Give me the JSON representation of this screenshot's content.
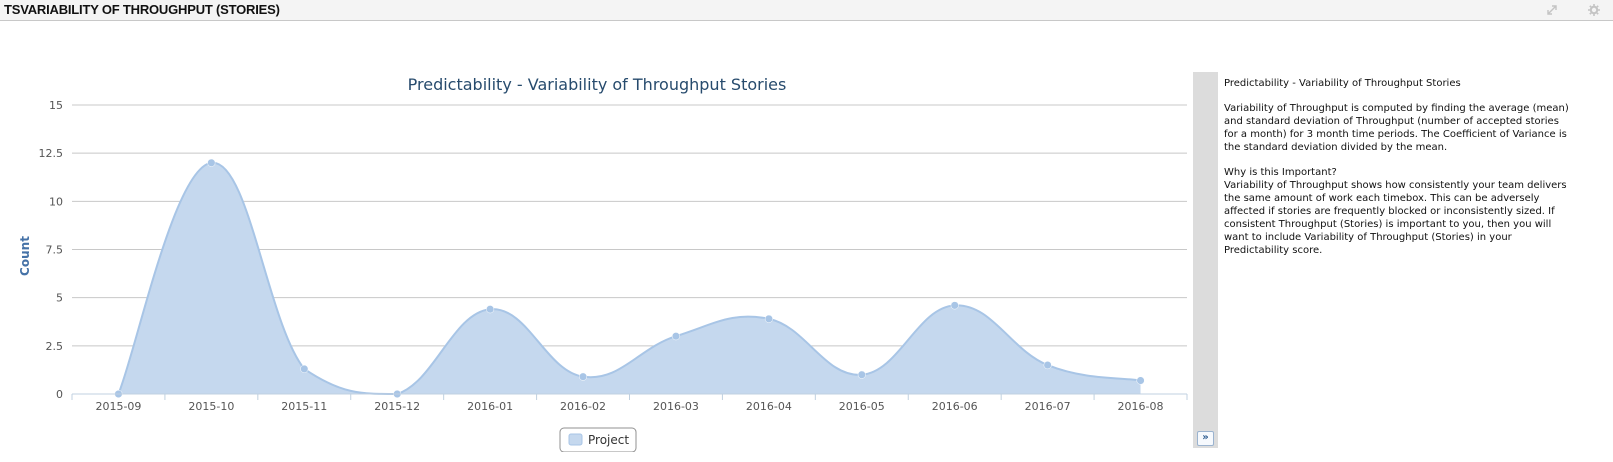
{
  "header": {
    "title": "TSVARIABILITY OF THROUGHPUT (STORIES)"
  },
  "chart_data": {
    "type": "area",
    "title": "Predictability - Variability of Throughput Stories",
    "xlabel": "",
    "ylabel": "Count",
    "categories": [
      "2015-09",
      "2015-10",
      "2015-11",
      "2015-12",
      "2016-01",
      "2016-02",
      "2016-03",
      "2016-04",
      "2016-05",
      "2016-06",
      "2016-07",
      "2016-08"
    ],
    "series": [
      {
        "name": "Project",
        "values": [
          0,
          12,
          1.3,
          0,
          4.4,
          0.9,
          3.0,
          3.9,
          1.0,
          4.6,
          1.5,
          0.7
        ]
      }
    ],
    "ylim": [
      0,
      15
    ],
    "yticks": [
      "0",
      "2.5",
      "5",
      "7.5",
      "10",
      "12.5",
      "15"
    ],
    "grid": true,
    "legend_position": "bottom-center",
    "colors": {
      "area_fill": "#c5d8ee",
      "line": "#a8c5e6",
      "point": "#a8c5e6",
      "title": "#274b6d",
      "axis_label": "#4572a7"
    }
  },
  "description": {
    "heading": "Predictability - Variability of Throughput Stories",
    "para1": "Variability of Throughput is computed by finding the average (mean) and standard deviation of Throughput (number of accepted stories for a month) for 3 month time periods. The Coefficient of Variance is the standard deviation divided by the mean.",
    "question": "Why is this Important?",
    "para2": "Variability of Throughput shows how consistently your team delivers the same amount of work each timebox. This can be adversely affected if stories are frequently blocked or inconsistently sized. If consistent Throughput (Stories) is important to you, then you will want to include Variability of Throughput (Stories) in your Predictability score."
  },
  "icons": {
    "expand": "expand-icon",
    "settings": "gear-icon",
    "toggle": "double-chevron-right-icon"
  }
}
